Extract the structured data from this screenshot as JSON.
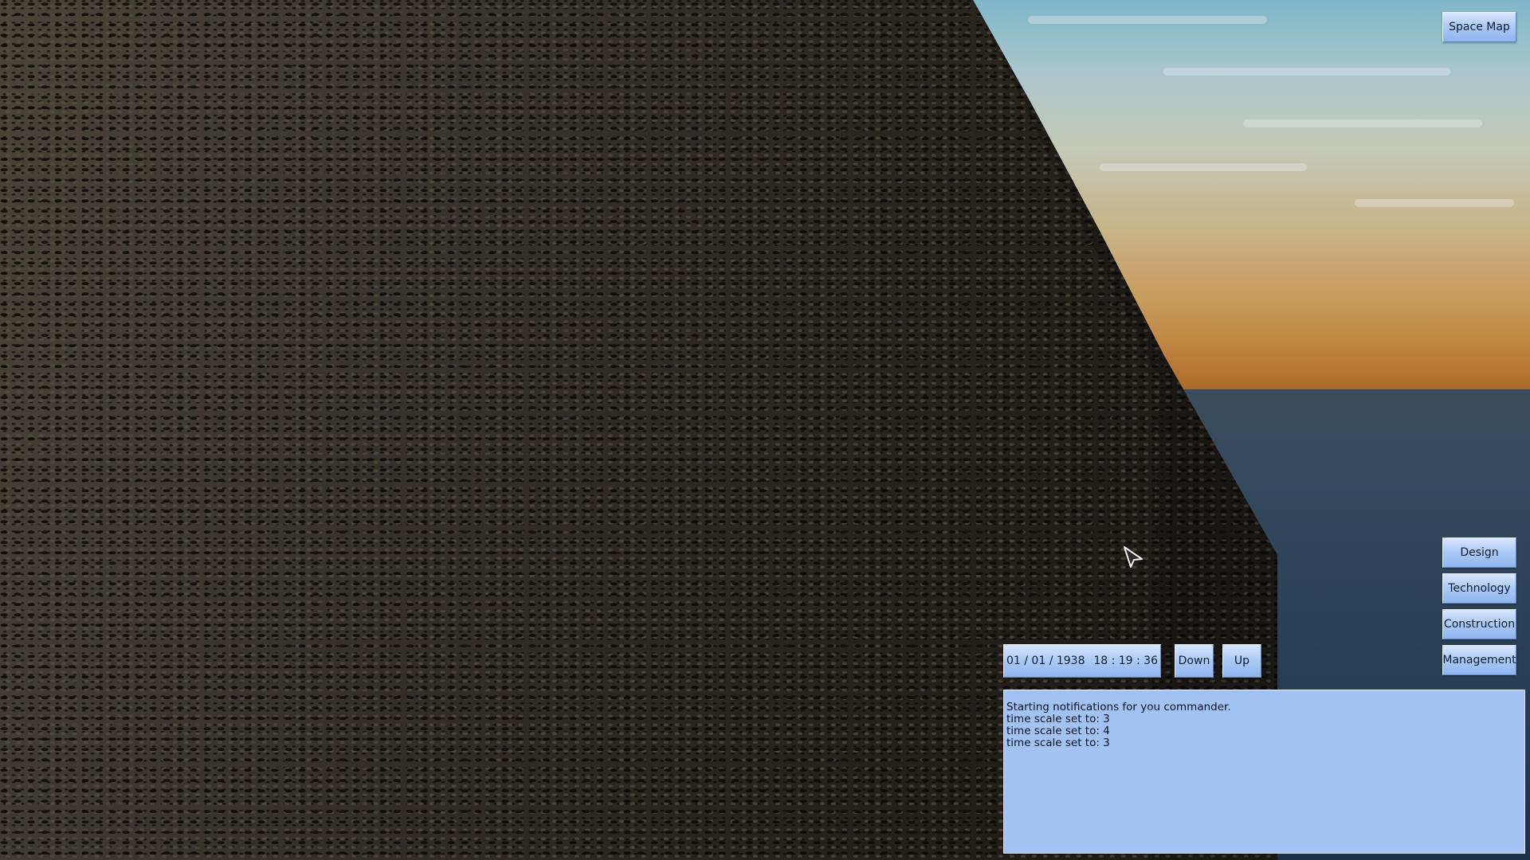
{
  "buttons": {
    "space_map": "Space Map",
    "design": "Design",
    "technology": "Technology",
    "construction": "Construction",
    "management": "Management"
  },
  "time_control": {
    "date": "01 / 01 / 1938",
    "time": "18 : 19 : 36",
    "down_label": "Down",
    "up_label": "Up"
  },
  "notifications": {
    "lines": [
      "Starting notifications for you commander.",
      "time scale set to: 3",
      "time scale set to: 4",
      "time scale set to: 3"
    ]
  },
  "colors": {
    "button_fill": "#aecbf6",
    "log_fill": "#a1c2f3",
    "wall": "#2c2822",
    "sea": "#2c4258"
  },
  "icons": {
    "cursor": "arrow-cursor-icon"
  }
}
